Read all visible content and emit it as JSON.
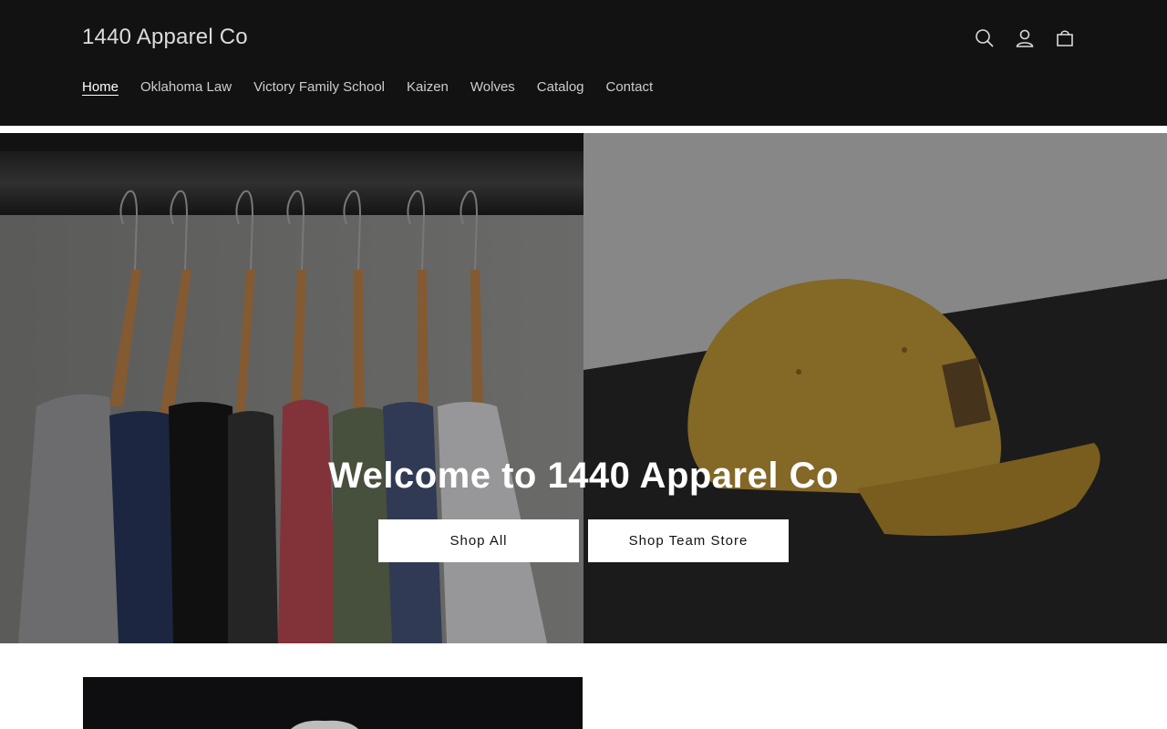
{
  "header": {
    "logo": "1440 Apparel Co",
    "nav": [
      {
        "label": "Home",
        "active": true
      },
      {
        "label": "Oklahoma Law"
      },
      {
        "label": "Victory Family School"
      },
      {
        "label": "Kaizen"
      },
      {
        "label": "Wolves"
      },
      {
        "label": "Catalog"
      },
      {
        "label": "Contact"
      }
    ],
    "icons": [
      "search-icon",
      "account-icon",
      "cart-icon"
    ]
  },
  "hero": {
    "title": "Welcome to 1440 Apparel Co",
    "buttons": [
      {
        "label": "Shop All"
      },
      {
        "label": "Shop Team Store"
      }
    ]
  },
  "colors": {
    "header_bg": "#121212",
    "text_on_dark": "#ffffff",
    "button_bg": "#ffffff"
  }
}
